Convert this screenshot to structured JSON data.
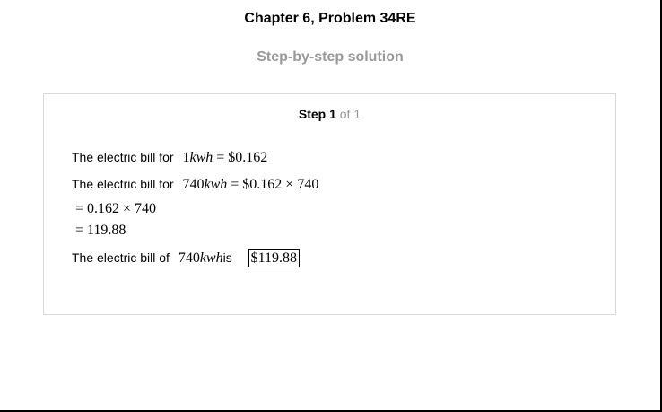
{
  "header": {
    "title": "Chapter 6, Problem 34RE",
    "subtitle": "Step-by-step solution"
  },
  "step": {
    "label": "Step 1",
    "of": "of 1"
  },
  "solution": {
    "line1_text": "The electric bill for",
    "line1_math_qty": "1",
    "line1_math_unit": "kwh",
    "line1_math_rhs": " = $0.162",
    "line2_text": "The electric bill for",
    "line2_math_qty": "740",
    "line2_math_unit": "kwh",
    "line2_math_rhs": " = $0.162 × 740",
    "line3_math": "= 0.162 × 740",
    "line4_math": "= 119.88",
    "line5_text": "The electric bill of",
    "line5_math_qty": "740",
    "line5_math_unit": "kwh",
    "line5_is": "is",
    "answer": "$119.88"
  }
}
